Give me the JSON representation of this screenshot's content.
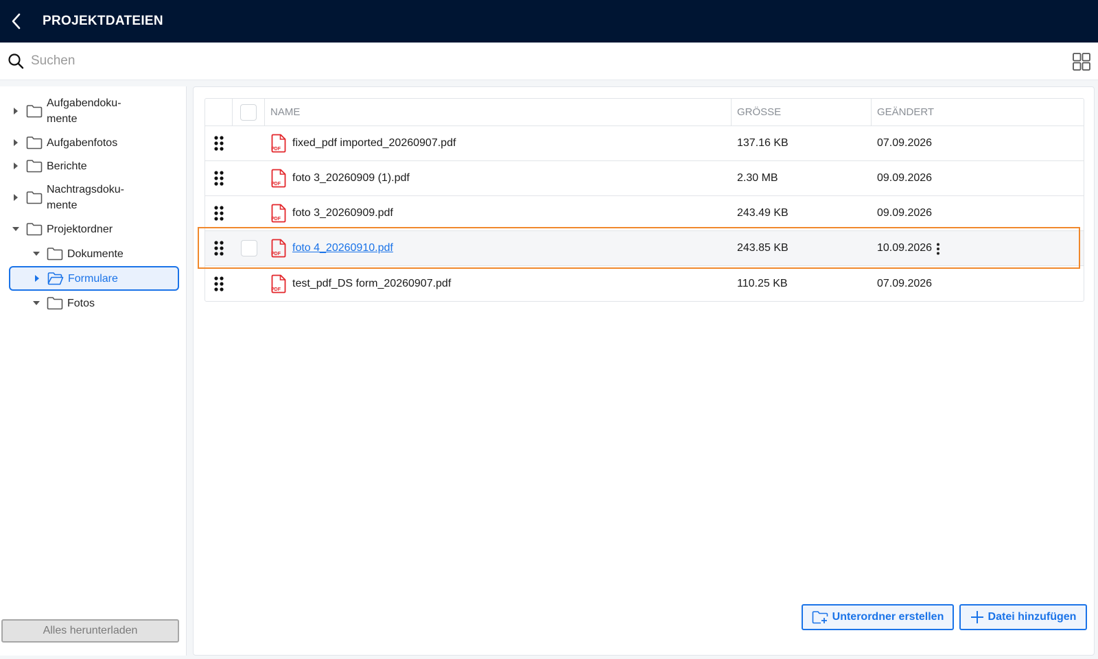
{
  "header": {
    "title": "PROJEKTDATEIEN"
  },
  "search": {
    "placeholder": "Suchen"
  },
  "sidebar": {
    "tree": [
      {
        "label": "Aufgabendoku-\nmente",
        "label_line1": "Aufgabendoku-",
        "label_line2": "mente",
        "state": "collapsed"
      },
      {
        "label": "Aufgabenfotos",
        "state": "collapsed"
      },
      {
        "label": "Berichte",
        "state": "collapsed"
      },
      {
        "label_line1": "Nachtragsdoku-",
        "label_line2": "mente",
        "state": "collapsed"
      },
      {
        "label": "Projektordner",
        "state": "expanded"
      },
      {
        "label": "Dokumente",
        "state": "expanded"
      },
      {
        "label": "Formulare",
        "state": "collapsed",
        "selected": true
      },
      {
        "label": "Fotos",
        "state": "expanded"
      }
    ],
    "download_all_label": "Alles herunterladen"
  },
  "table": {
    "columns": {
      "name": "NAME",
      "size": "GRÖSSE",
      "modified": "GEÄNDERT"
    },
    "rows": [
      {
        "name": "fixed_pdf imported_20260907.pdf",
        "size": "137.16 KB",
        "modified": "07.09.2026"
      },
      {
        "name": "foto 3_20260909 (1).pdf",
        "size": "2.30 MB",
        "modified": "09.09.2026"
      },
      {
        "name": "foto 3_20260909.pdf",
        "size": "243.49 KB",
        "modified": "09.09.2026"
      },
      {
        "name": "foto 4_20260910.pdf",
        "size": "243.85 KB",
        "modified": "10.09.2026",
        "hovered": true
      },
      {
        "name": "test_pdf_DS form_20260907.pdf",
        "size": "110.25 KB",
        "modified": "07.09.2026"
      }
    ]
  },
  "actions": {
    "create_subfolder_label": "Unterordner erstellen",
    "add_file_label": "Datei hinzufügen"
  },
  "colors": {
    "header_bg": "#001533",
    "accent": "#1a73e8",
    "highlight": "#f0882c",
    "pdf_red": "#e3262b"
  }
}
